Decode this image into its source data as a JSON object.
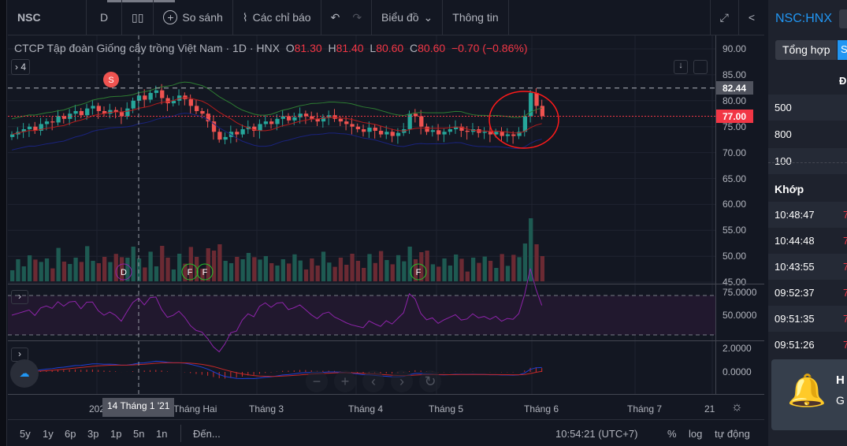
{
  "toolbar": {
    "symbol": "NSC",
    "interval": "D",
    "compare": "So sánh",
    "indicators": "Các chỉ báo",
    "chart_menu": "Biểu đồ",
    "info": "Thông tin"
  },
  "legend": {
    "name": "CTCP Tập đoàn Giống cây trồng Việt Nam · 1D · HNX",
    "o_label": "O",
    "o": "81.30",
    "h_label": "H",
    "h": "81.40",
    "l_label": "L",
    "l": "80.60",
    "c_label": "C",
    "c": "80.60",
    "change": "−0.70 (−0.86%)",
    "collapsed_count": "4"
  },
  "price_axis": {
    "ticks": [
      "90.00",
      "85.00",
      "80.00",
      "75.00",
      "70.00",
      "65.00",
      "60.00",
      "55.00",
      "50.00",
      "45.00"
    ],
    "high_label": "82.44",
    "last_label": "77.00"
  },
  "rsi_axis": {
    "ticks": [
      "75.0000",
      "50.0000"
    ]
  },
  "macd_axis": {
    "ticks": [
      "2.0000",
      "0.0000"
    ]
  },
  "time_axis": {
    "labels": [
      "202",
      "Tháng Hai",
      "Tháng 3",
      "Tháng 4",
      "Tháng 5",
      "Tháng 6",
      "Tháng 7",
      "21"
    ],
    "crosshair": "14 Tháng 1 '21"
  },
  "markers": {
    "sell": "S",
    "dividend": "D",
    "financial": "F"
  },
  "bottom": {
    "ranges": [
      "5y",
      "1y",
      "6p",
      "3p",
      "1p",
      "5n",
      "1n"
    ],
    "goto": "Đến...",
    "clock": "10:54:21 (UTC+7)",
    "percent": "%",
    "log": "log",
    "auto": "tự động"
  },
  "right_panel": {
    "symbol": "NSC:HNX",
    "tab1": "Tổng hợp",
    "tab2": "S",
    "header": "Đ",
    "volumes": [
      "500",
      "800",
      "100"
    ],
    "trades_title": "Khớp",
    "trades": [
      "10:48:47",
      "10:44:48",
      "10:43:55",
      "09:52:37",
      "09:51:35",
      "09:51:26"
    ],
    "trade_price_prefix": "7",
    "alert_title": "H",
    "alert_sub": "G"
  },
  "colors": {
    "up": "#26a69a",
    "down": "#ef5350",
    "last": "#f23645",
    "bg": "#131722"
  },
  "chart_data": {
    "type": "candlestick",
    "closes": [
      73.5,
      74,
      74.5,
      75,
      74.2,
      75.5,
      76,
      75.8,
      77,
      76.5,
      77.5,
      78,
      77.2,
      78.5,
      79,
      78,
      77.5,
      78.2,
      77.8,
      77,
      78.5,
      80,
      81,
      80.2,
      81.5,
      82,
      80.5,
      79.5,
      80,
      81,
      80.3,
      79,
      78,
      77.5,
      76,
      74,
      72.5,
      73,
      74,
      73.5,
      74.5,
      75,
      74.2,
      75.5,
      76,
      75.5,
      76.5,
      77,
      76.2,
      76.8,
      77.5,
      77,
      76.5,
      76,
      76.8,
      77.2,
      76.5,
      76,
      75.5,
      75,
      74.5,
      74,
      74.8,
      74.2,
      73.5,
      74,
      73.2,
      73.8,
      74.5,
      77.5,
      77,
      75,
      74,
      74.3,
      73.5,
      74,
      74.5,
      75,
      74.2,
      74,
      74.5,
      73.8,
      74,
      73.5,
      74,
      73.2,
      73.5,
      73.2,
      74,
      77,
      81.5,
      79,
      77
    ]
  }
}
